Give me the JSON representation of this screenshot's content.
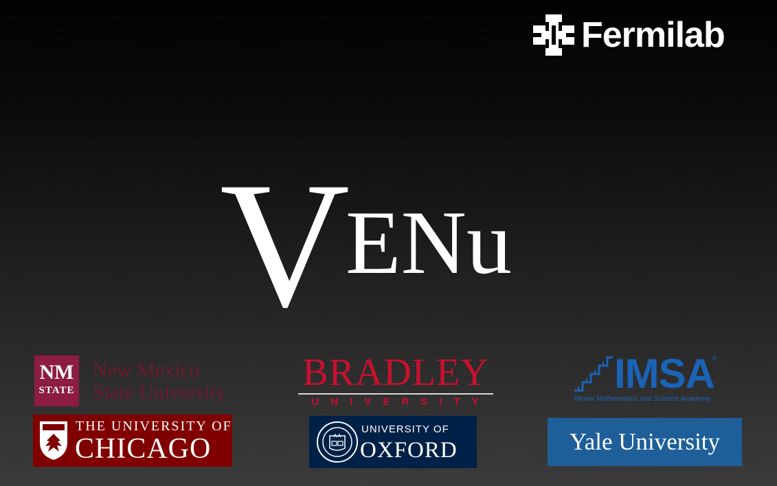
{
  "title": {
    "initial": "V",
    "rest": "ENu"
  },
  "fermilab": {
    "name": "Fermilab",
    "icon": "fermilab-logo-icon"
  },
  "logos": {
    "nmsu": {
      "box_top": "NM",
      "box_bottom": "STATE",
      "line1": "New Mexico",
      "line2": "State University",
      "colors": {
        "box": "#8c1d40",
        "text": "#6c1a2f"
      }
    },
    "bradley": {
      "line1": "BRADLEY",
      "line2": "UNIVERSITY",
      "color": "#c8102e"
    },
    "imsa": {
      "name": "IMSA",
      "registered": "®",
      "full_name": "Illinois Mathematics and Science Academy",
      "icon": "imsa-steps-icon",
      "color": "#1a63b6"
    },
    "chicago": {
      "line1": "THE UNIVERSITY OF",
      "line2": "CHICAGO",
      "icon": "phoenix-shield-icon",
      "color": "#800000"
    },
    "oxford": {
      "line1": "UNIVERSITY OF",
      "line2": "OXFORD",
      "icon": "oxford-seal-icon",
      "color": "#002147"
    },
    "yale": {
      "name": "Yale University",
      "color": "#1e5f99"
    }
  }
}
